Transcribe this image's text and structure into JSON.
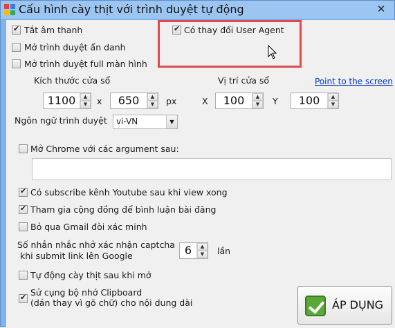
{
  "window": {
    "title": "Cấu hình cày thịt với trình duyệt tự động",
    "close_glyph": "✕"
  },
  "options_top": {
    "mute": {
      "label": "Tắt âm thanh",
      "checked": true
    },
    "incognito": {
      "label": "Mở trình duyệt ẩn danh",
      "checked": false
    },
    "fullscreen": {
      "label": "Mở trình duyệt full màn hình",
      "checked": false
    },
    "user_agent": {
      "label": "Có thay đổi User Agent",
      "checked": true
    }
  },
  "window_size": {
    "label": "Kích thước cửa sổ",
    "width": "1100",
    "x_sep": "x",
    "height": "650",
    "unit": "px"
  },
  "window_position": {
    "label": "Vị trí cửa sổ",
    "x_label": "X",
    "x": "100",
    "y_label": "Y",
    "y": "100",
    "point_link": "Point to the screen"
  },
  "language": {
    "label": "Ngôn ngữ trình duyệt",
    "value": "vi-VN"
  },
  "chrome_args": {
    "label": "Mở Chrome với các argument sau:",
    "checked": false,
    "value": ""
  },
  "options_bottom": {
    "subscribe": {
      "label": "Có subscribe kênh Youtube sau khi view xong",
      "checked": true
    },
    "community": {
      "label": "Tham gia cộng đồng để bình luận bài đăng",
      "checked": true
    },
    "skip_gmail": {
      "label": "Bỏ qua Gmail đòi xác minh",
      "checked": false
    }
  },
  "captcha": {
    "line1": "Số nhắn nhắc nhở xác nhận captcha",
    "line2": "khi submit link lên Google",
    "value": "6",
    "unit": "lần"
  },
  "options_tail": {
    "auto_start": {
      "label": "Tự động cày thịt sau khi mở",
      "checked": false
    },
    "clipboard": {
      "line1": "Sử cụng bộ nhớ Clipboard",
      "line2": "(dán thay vì gõ chữ) cho nội dung dài",
      "checked": true
    }
  },
  "apply_button": {
    "label": "ÁP DỤNG",
    "icon": "checkmark-icon"
  },
  "colors": {
    "highlight": "#e0494a",
    "link": "#0033cc",
    "title_bar": "#9cc6f1"
  }
}
